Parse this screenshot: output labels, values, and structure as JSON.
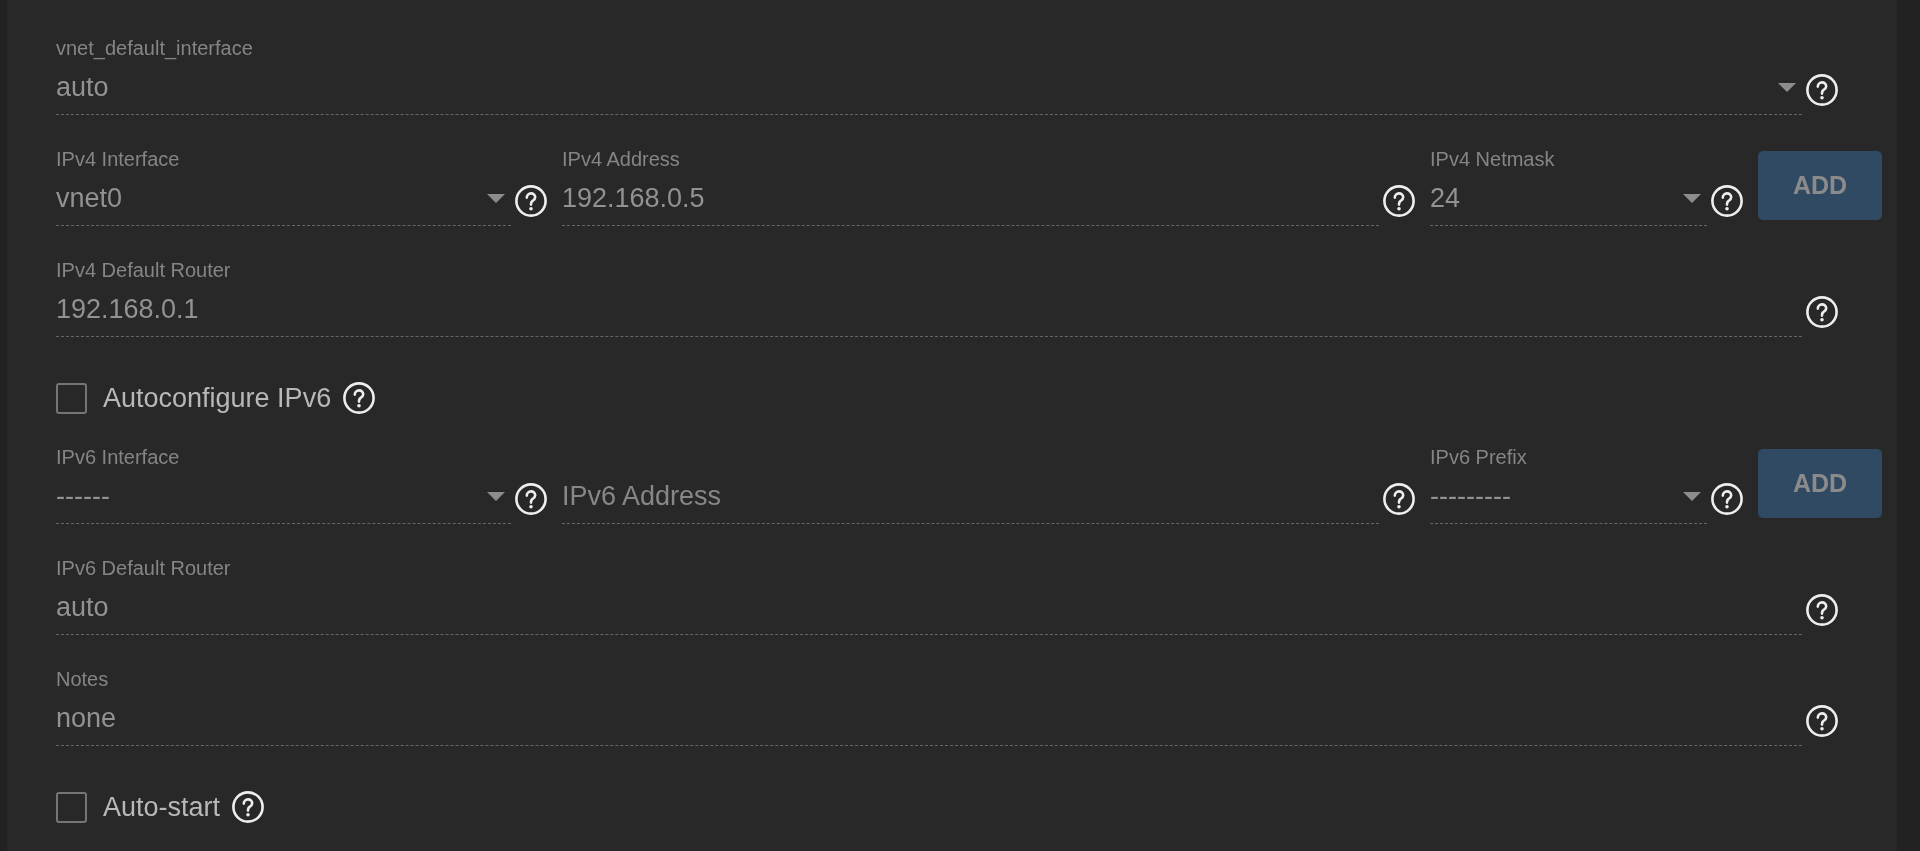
{
  "form": {
    "rows": [
      {
        "kind": "fields",
        "fields": [
          {
            "kind": "select",
            "label": "vnet_default_interface",
            "value": "auto"
          }
        ]
      },
      {
        "kind": "fields",
        "fields": [
          {
            "kind": "select",
            "label": "IPv4 Interface",
            "value": "vnet0"
          },
          {
            "kind": "input",
            "label": "IPv4 Address",
            "value": "192.168.0.5"
          },
          {
            "kind": "select",
            "label": "IPv4 Netmask",
            "value": "24"
          }
        ],
        "button": {
          "label": "ADD",
          "disabled": true
        }
      },
      {
        "kind": "fields",
        "fields": [
          {
            "kind": "input",
            "label": "IPv4 Default Router",
            "value": "192.168.0.1"
          }
        ]
      },
      {
        "kind": "checkbox",
        "label": "Autoconfigure IPv6",
        "checked": false
      },
      {
        "kind": "fields",
        "fields": [
          {
            "kind": "select",
            "label": "IPv6 Interface",
            "value": "------"
          },
          {
            "kind": "input",
            "placeholder": "IPv6 Address"
          },
          {
            "kind": "select",
            "label": "IPv6 Prefix",
            "value": "---------"
          }
        ],
        "button": {
          "label": "ADD",
          "disabled": true
        }
      },
      {
        "kind": "fields",
        "fields": [
          {
            "kind": "input",
            "label": "IPv6 Default Router",
            "value": "auto"
          }
        ]
      },
      {
        "kind": "fields",
        "fields": [
          {
            "kind": "input",
            "label": "Notes",
            "value": "none"
          }
        ]
      },
      {
        "kind": "checkbox",
        "label": "Auto-start",
        "checked": false
      }
    ]
  }
}
